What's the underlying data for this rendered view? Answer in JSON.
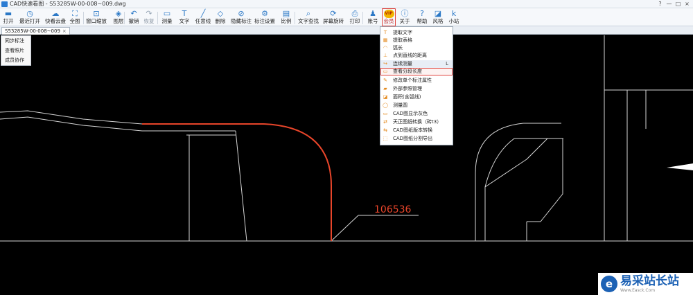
{
  "window": {
    "title": "CAD快速看图 - S53285W-00-008~009.dwg",
    "minimize": "—",
    "maximize": "□",
    "close": "×",
    "help": "?"
  },
  "toolbar": {
    "items": [
      {
        "label": "打开",
        "icon": "folder-icon",
        "glyph": "▬"
      },
      {
        "label": "最近打开",
        "icon": "clock-icon",
        "glyph": "◷"
      },
      {
        "label": "快看云盘",
        "icon": "cloud-icon",
        "glyph": "☁"
      },
      {
        "label": "全图",
        "icon": "fit-all-icon",
        "glyph": "⛶"
      },
      {
        "label": "窗口缩放",
        "icon": "window-zoom-icon",
        "glyph": "⊡"
      },
      {
        "label": "图层",
        "icon": "layers-icon",
        "glyph": "◈"
      },
      {
        "label": "撤销",
        "icon": "undo-icon",
        "glyph": "↶"
      },
      {
        "label": "恢复",
        "icon": "redo-icon",
        "glyph": "↷",
        "disabled": true
      },
      {
        "label": "测量",
        "icon": "measure-icon",
        "glyph": "▭"
      },
      {
        "label": "文字",
        "icon": "text-icon",
        "glyph": "T"
      },
      {
        "label": "任意线",
        "icon": "freeline-icon",
        "glyph": "╱"
      },
      {
        "label": "删除",
        "icon": "eraser-icon",
        "glyph": "◇"
      },
      {
        "label": "隐藏标注",
        "icon": "hide-annotation-icon",
        "glyph": "⊘"
      },
      {
        "label": "标注设置",
        "icon": "annotation-settings-icon",
        "glyph": "⚙"
      },
      {
        "label": "比例",
        "icon": "scale-icon",
        "glyph": "▤"
      },
      {
        "label": "文字查找",
        "icon": "text-search-icon",
        "glyph": "⌕"
      },
      {
        "label": "屏幕旋转",
        "icon": "rotate-screen-icon",
        "glyph": "⟳"
      },
      {
        "label": "打印",
        "icon": "printer-icon",
        "glyph": "⎙"
      },
      {
        "label": "账号",
        "icon": "user-icon",
        "glyph": "♟"
      },
      {
        "label": "会员",
        "icon": "vip-icon",
        "glyph": "VIP"
      },
      {
        "label": "关于",
        "icon": "info-icon",
        "glyph": "ⓘ"
      },
      {
        "label": "帮助",
        "icon": "help-icon",
        "glyph": "?"
      },
      {
        "label": "风格",
        "icon": "style-icon",
        "glyph": "◪"
      },
      {
        "label": "小站",
        "icon": "site-icon",
        "glyph": "k"
      }
    ]
  },
  "tab": {
    "label": "S53285W-00-008~009",
    "close": "×"
  },
  "left_menu": [
    "同步标注",
    "查看照片",
    "成员协作"
  ],
  "dropdown": {
    "items": [
      {
        "label": "提取文字",
        "icon": "extract-text-icon",
        "glyph": "T"
      },
      {
        "label": "提取表格",
        "icon": "extract-table-icon",
        "glyph": "▦"
      },
      {
        "label": "弧长",
        "icon": "arc-length-icon",
        "glyph": "◠"
      },
      {
        "label": "点到直线的距离",
        "icon": "point-line-distance-icon",
        "glyph": "⊥"
      },
      {
        "label": "连续测量",
        "icon": "continuous-measure-icon",
        "glyph": "↪",
        "shortcut": "L"
      },
      {
        "label": "查看分段长度",
        "icon": "segment-length-icon",
        "glyph": "▭"
      },
      {
        "label": "修改单个标注属性",
        "icon": "edit-annotation-icon",
        "glyph": "✎"
      },
      {
        "label": "外部参照管理",
        "icon": "xref-icon",
        "glyph": "▰"
      },
      {
        "label": "面积(含弧线)",
        "icon": "area-icon",
        "glyph": "◪"
      },
      {
        "label": "测量圆",
        "icon": "measure-circle-icon",
        "glyph": "◯"
      },
      {
        "label": "CAD图显示灰色",
        "icon": "gray-display-icon",
        "glyph": "▭"
      },
      {
        "label": "天正图纸转换（砖t3）",
        "icon": "tangent-convert-icon",
        "glyph": "⇄"
      },
      {
        "label": "CAD图纸版本转换",
        "icon": "version-convert-icon",
        "glyph": "⇆"
      },
      {
        "label": "CAD图纸分割导出",
        "icon": "split-export-icon",
        "glyph": "⬚"
      }
    ]
  },
  "drawing": {
    "dimension_text": "106536",
    "highlight_color": "#e8452a",
    "line_color": "#d6d6d6"
  },
  "watermark": {
    "logo": "e",
    "name": "易采站长站",
    "url": "Www.Easck.Com"
  }
}
